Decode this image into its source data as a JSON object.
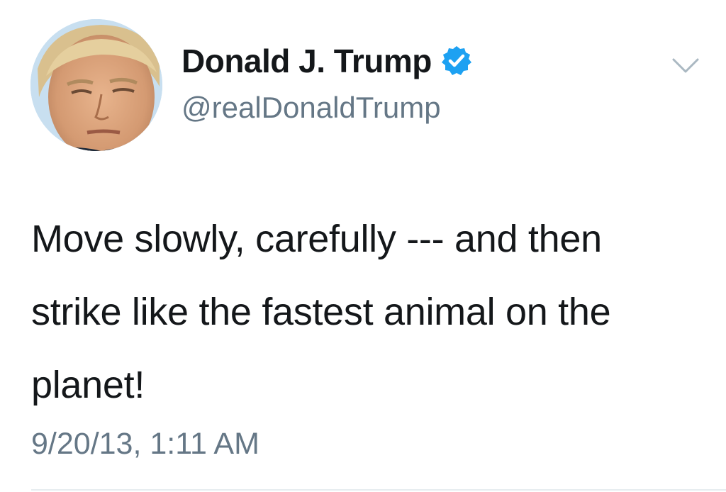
{
  "tweet": {
    "author": {
      "display_name": "Donald J. Trump",
      "handle": "@realDonaldTrump",
      "verified": true,
      "avatar_icon": "profile-photo"
    },
    "text": "Move slowly, carefully --- and then strike like the fastest animal on the planet!",
    "timestamp": "9/20/13, 1:11 AM",
    "menu_icon": "chevron-down-icon"
  },
  "colors": {
    "verified_badge": "#1da1f2",
    "secondary_text": "#657786",
    "primary_text": "#14171a",
    "divider": "#e6ecf0"
  }
}
